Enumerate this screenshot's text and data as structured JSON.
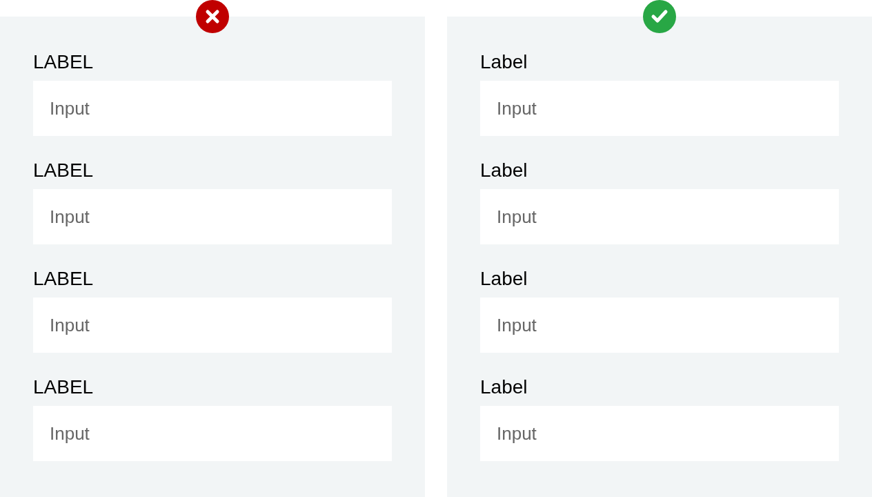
{
  "panels": [
    {
      "kind": "dont",
      "fields": [
        {
          "label": "LABEL",
          "placeholder": "Input"
        },
        {
          "label": "LABEL",
          "placeholder": "Input"
        },
        {
          "label": "LABEL",
          "placeholder": "Input"
        },
        {
          "label": "LABEL",
          "placeholder": "Input"
        }
      ]
    },
    {
      "kind": "do",
      "fields": [
        {
          "label": "Label",
          "placeholder": "Input"
        },
        {
          "label": "Label",
          "placeholder": "Input"
        },
        {
          "label": "Label",
          "placeholder": "Input"
        },
        {
          "label": "Label",
          "placeholder": "Input"
        }
      ]
    }
  ]
}
